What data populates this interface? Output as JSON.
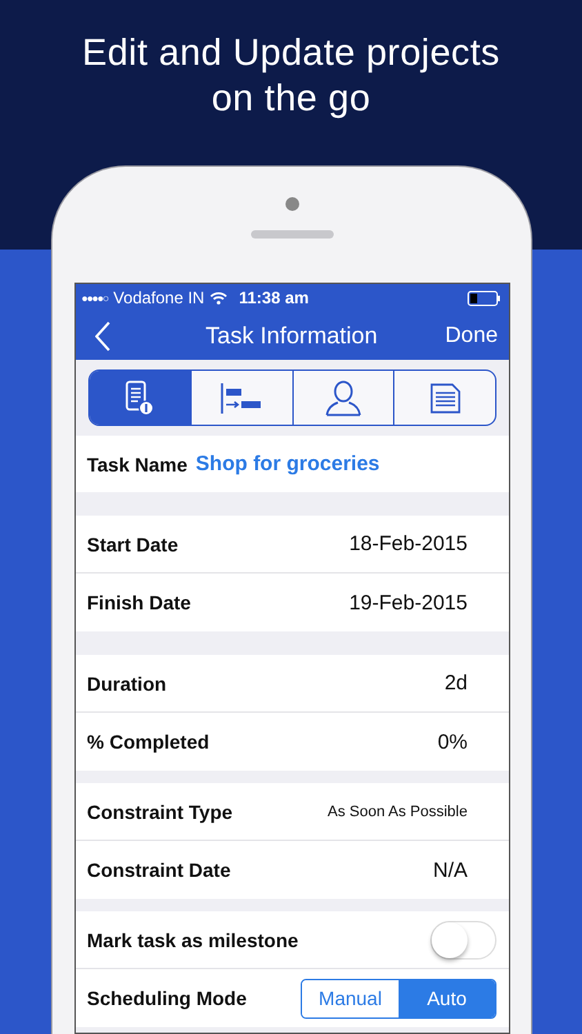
{
  "headline_lines": [
    "Edit and Update projects",
    "on the go"
  ],
  "status_bar": {
    "signal": "●●●●○",
    "carrier": "Vodafone IN",
    "time": "11:38 am"
  },
  "nav": {
    "title": "Task Information",
    "done": "Done"
  },
  "tabs": [
    {
      "kind": "info",
      "selected": true
    },
    {
      "kind": "gantt",
      "selected": false
    },
    {
      "kind": "person",
      "selected": false
    },
    {
      "kind": "notes",
      "selected": false
    }
  ],
  "task_name": {
    "label": "Task Name",
    "value": "Shop for groceries"
  },
  "sections": [
    [
      {
        "kind": "value",
        "label": "Start Date",
        "value": "18-Feb-2015"
      },
      {
        "kind": "value",
        "label": "Finish Date",
        "value": "19-Feb-2015"
      }
    ],
    [
      {
        "kind": "value",
        "label": "Duration",
        "value": "2d"
      },
      {
        "kind": "value",
        "label": "% Completed",
        "value": "0%"
      }
    ],
    [
      {
        "kind": "small",
        "label": "Constraint Type",
        "value": "As Soon As Possible"
      },
      {
        "kind": "value",
        "label": "Constraint Date",
        "value": "N/A"
      }
    ],
    [
      {
        "kind": "toggle",
        "label": "Mark task as milestone",
        "on": false
      },
      {
        "kind": "segmented",
        "label": "Scheduling Mode",
        "options": [
          {
            "label": "Manual",
            "selected": false
          },
          {
            "label": "Auto",
            "selected": true
          }
        ]
      }
    ]
  ]
}
